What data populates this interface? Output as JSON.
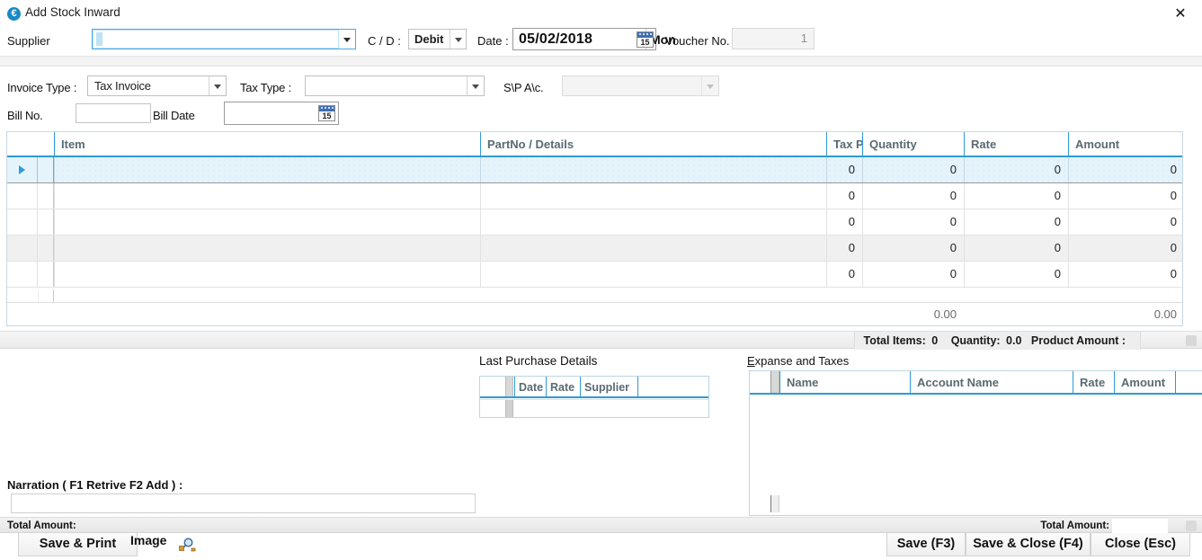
{
  "window": {
    "title": "Add Stock Inward",
    "icon": "app-circle-icon",
    "close_label": "✕",
    "accent_color": "#2e9bd6"
  },
  "header": {
    "supplier_label": "Supplier",
    "supplier_value": "",
    "supplier_placeholder": "",
    "cd_label": "C / D :",
    "cd_value": "Debit",
    "date_label": "Date :",
    "date_value": "05/02/2018",
    "date_day": "Mon",
    "calendar_day_number": "15",
    "voucher_label": "Voucher No.",
    "voucher_value": "1"
  },
  "details": {
    "invoice_type_label": "Invoice Type :",
    "invoice_type_value": "Tax Invoice",
    "tax_type_label": "Tax Type :",
    "tax_type_value": "",
    "sp_ac_label": "S\\P  A\\c.",
    "sp_ac_value": "",
    "bill_no_label": "Bill No.",
    "bill_no_value": "",
    "bill_date_label": "Bill Date",
    "bill_date_value": "",
    "bill_date_calendar_number": "15"
  },
  "grid": {
    "columns": [
      {
        "key": "item",
        "label": "Item"
      },
      {
        "key": "partno",
        "label": "PartNo / Details"
      },
      {
        "key": "taxp",
        "label": "Tax P"
      },
      {
        "key": "quantity",
        "label": "Quantity"
      },
      {
        "key": "rate",
        "label": "Rate"
      },
      {
        "key": "amount",
        "label": "Amount"
      }
    ],
    "rows": [
      {
        "item": "",
        "partno": "",
        "taxp": "0",
        "quantity": "0",
        "rate": "0",
        "amount": "0",
        "state": "selected"
      },
      {
        "item": "",
        "partno": "",
        "taxp": "0",
        "quantity": "0",
        "rate": "0",
        "amount": "0",
        "state": "normal"
      },
      {
        "item": "",
        "partno": "",
        "taxp": "0",
        "quantity": "0",
        "rate": "0",
        "amount": "0",
        "state": "normal"
      },
      {
        "item": "",
        "partno": "",
        "taxp": "0",
        "quantity": "0",
        "rate": "0",
        "amount": "0",
        "state": "hover"
      },
      {
        "item": "",
        "partno": "",
        "taxp": "0",
        "quantity": "0",
        "rate": "0",
        "amount": "0",
        "state": "normal"
      }
    ],
    "footer": {
      "quantity_total": "0.00",
      "amount_total": "0.00"
    }
  },
  "summary": {
    "total_items_label": "Total Items:",
    "total_items_value": "0",
    "quantity_label": "Quantity:",
    "quantity_value": "0.0",
    "product_amount_label": "Product Amount :",
    "product_amount_value": ""
  },
  "last_purchase": {
    "title": "Last Purchase Details",
    "columns": [
      "Date",
      "Rate",
      "Supplier"
    ],
    "rows": []
  },
  "expanse": {
    "title_accel": "E",
    "title_rest": "xpanse and Taxes",
    "columns": [
      "Name",
      "Account Name",
      "Rate",
      "Amount"
    ],
    "rows": []
  },
  "narration": {
    "label": "Narration ( F1 Retrive F2 Add ) :",
    "value": ""
  },
  "totals": {
    "left_label": "Total  Amount:",
    "left_value": "",
    "right_label": "Total  Amount:",
    "right_value": ""
  },
  "footer": {
    "save_print_label": "Save & Print",
    "image_label": "Image",
    "image_icon": "magnifier-folder-icon",
    "save_label": "Save (F3)",
    "save_close_label": "Save & Close (F4)",
    "close_label": "Close (Esc)"
  }
}
